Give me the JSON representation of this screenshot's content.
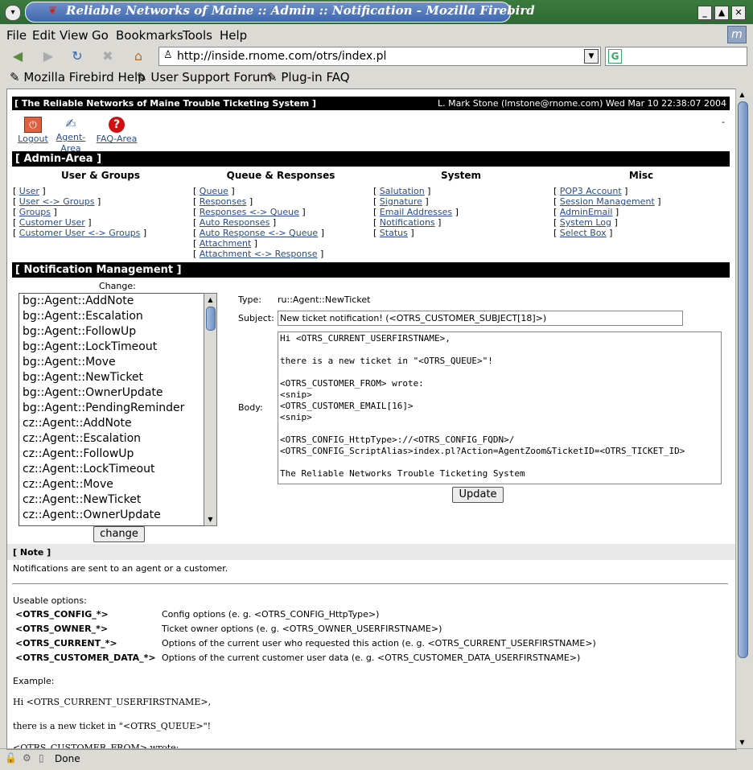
{
  "window": {
    "title": "Reliable Networks of Maine :: Admin :: Notification - Mozilla Firebird"
  },
  "menu": [
    "File",
    "Edit",
    "View",
    "Go",
    "Bookmarks",
    "Tools",
    "Help"
  ],
  "address": {
    "url": "http://inside.rnome.com/otrs/index.pl"
  },
  "bookmarks": [
    "Mozilla Firebird Help",
    "User Support Forum",
    "Plug-in FAQ"
  ],
  "header": {
    "system_title": "[ The Reliable Networks of Maine Trouble Ticketing System ]",
    "user_info": "L. Mark Stone (lmstone@rnome.com) Wed Mar 10 22:38:07 2004",
    "dash": "-"
  },
  "toolbar": {
    "logout": "Logout",
    "agent_area": "Agent-Area",
    "faq_area": "FAQ-Area"
  },
  "admin_area": {
    "title": "[ Admin-Area ]",
    "columns": [
      {
        "heading": "User & Groups",
        "items": [
          "User",
          "User <-> Groups",
          "Groups",
          "Customer User",
          "Customer User <-> Groups"
        ]
      },
      {
        "heading": "Queue & Responses",
        "items": [
          "Queue",
          "Responses",
          "Responses <-> Queue",
          "Auto Responses",
          "Auto Response <-> Queue",
          "Attachment",
          "Attachment <-> Response"
        ]
      },
      {
        "heading": "System",
        "items": [
          "Salutation",
          "Signature",
          "Email Addresses",
          "Notifications",
          "Status"
        ]
      },
      {
        "heading": "Misc",
        "items": [
          "POP3 Account",
          "Session Management",
          "AdminEmail",
          "System Log",
          "Select Box"
        ]
      }
    ]
  },
  "notification": {
    "title": "[ Notification Management ]",
    "change_label": "Change:",
    "list": [
      "bg::Agent::AddNote",
      "bg::Agent::Escalation",
      "bg::Agent::FollowUp",
      "bg::Agent::LockTimeout",
      "bg::Agent::Move",
      "bg::Agent::NewTicket",
      "bg::Agent::OwnerUpdate",
      "bg::Agent::PendingReminder",
      "cz::Agent::AddNote",
      "cz::Agent::Escalation",
      "cz::Agent::FollowUp",
      "cz::Agent::LockTimeout",
      "cz::Agent::Move",
      "cz::Agent::NewTicket",
      "cz::Agent::OwnerUpdate"
    ],
    "change_button": "change",
    "type_label": "Type:",
    "type_value": "ru::Agent::NewTicket",
    "subject_label": "Subject:",
    "subject_value": "New ticket notification! (<OTRS_CUSTOMER_SUBJECT[18]>)",
    "body_label": "Body:",
    "body_value": "Hi <OTRS_CURRENT_USERFIRSTNAME>,\n\nthere is a new ticket in \"<OTRS_QUEUE>\"!\n\n<OTRS_CUSTOMER_FROM> wrote:\n<snip>\n<OTRS_CUSTOMER_EMAIL[16]>\n<snip>\n\n<OTRS_CONFIG_HttpType>://<OTRS_CONFIG_FQDN>/\n<OTRS_CONFIG_ScriptAlias>index.pl?Action=AgentZoom&TicketID=<OTRS_TICKET_ID>\n\nThe Reliable Networks Trouble Ticketing System",
    "update_button": "Update"
  },
  "note": {
    "title": "[ Note ]",
    "text": "Notifications are sent to an agent or a customer.",
    "useable": "Useable options:",
    "options": [
      {
        "key": "<OTRS_CONFIG_*>",
        "desc": "Config options (e. g. <OTRS_CONFIG_HttpType>)"
      },
      {
        "key": "<OTRS_OWNER_*>",
        "desc": "Ticket owner options (e. g. <OTRS_OWNER_USERFIRSTNAME>)"
      },
      {
        "key": "<OTRS_CURRENT_*>",
        "desc": "Options of the current user who requested this action (e. g. <OTRS_CURRENT_USERFIRSTNAME>)"
      },
      {
        "key": "<OTRS_CUSTOMER_DATA_*>",
        "desc": "Options of the current customer user data (e. g. <OTRS_CUSTOMER_DATA_USERFIRSTNAME>)"
      }
    ],
    "example_label": "Example:",
    "example_lines": [
      "Hi <OTRS_CURRENT_USERFIRSTNAME>,",
      "there is a new ticket in \"<OTRS_QUEUE>\"!",
      "<OTRS_CUSTOMER_FROM> wrote:"
    ]
  },
  "status": {
    "text": "Done"
  }
}
